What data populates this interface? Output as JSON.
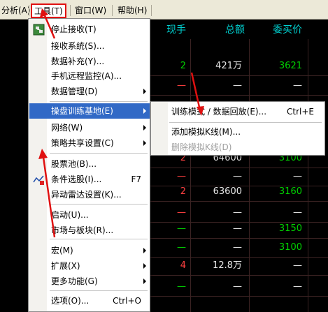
{
  "menubar": {
    "items": [
      {
        "label": "分析(A)",
        "active": false
      },
      {
        "label": "工具(T)",
        "active": true
      },
      {
        "label": "窗口(W)",
        "active": false
      },
      {
        "label": "帮助(H)",
        "active": false
      }
    ]
  },
  "table": {
    "headers": [
      "现手",
      "总额",
      "委买价"
    ],
    "rows": [
      {
        "shou": "2",
        "zong": "421万",
        "wei": "3621",
        "shou_color": "green",
        "wei_color": "green"
      },
      {
        "shou": "—",
        "zong": "—",
        "wei": "—",
        "shou_color": "red",
        "wei_color": "white"
      },
      {
        "shou": "2",
        "zong": "64600",
        "wei": "3100",
        "shou_color": "red",
        "wei_color": "green"
      },
      {
        "shou": "—",
        "zong": "—",
        "wei": "—",
        "shou_color": "red",
        "wei_color": "white"
      },
      {
        "shou": "2",
        "zong": "63600",
        "wei": "3160",
        "shou_color": "red",
        "wei_color": "green"
      },
      {
        "shou": "—",
        "zong": "—",
        "wei": "—",
        "shou_color": "red",
        "wei_color": "white"
      },
      {
        "shou": "—",
        "zong": "—",
        "wei": "3150",
        "shou_color": "green",
        "wei_color": "green"
      },
      {
        "shou": "—",
        "zong": "—",
        "wei": "3100",
        "shou_color": "green",
        "wei_color": "green"
      },
      {
        "shou": "4",
        "zong": "12.8万",
        "wei": "—",
        "shou_color": "red",
        "wei_color": "white"
      },
      {
        "shou": "—",
        "zong": "—",
        "wei": "—",
        "shou_color": "green",
        "wei_color": "white"
      }
    ]
  },
  "tools_menu": {
    "items": [
      {
        "label": "停止接收(T)",
        "shortcut": "",
        "submenu": false,
        "icon": "network-icon"
      },
      {
        "label": "接收系统(S)...",
        "shortcut": "",
        "submenu": false
      },
      {
        "label": "数据补充(Y)...",
        "shortcut": "",
        "submenu": false
      },
      {
        "label": "手机远程监控(A)...",
        "shortcut": "",
        "submenu": false
      },
      {
        "label": "数据管理(D)",
        "shortcut": "",
        "submenu": true
      },
      {
        "label": "操盘训练基地(E)",
        "shortcut": "",
        "submenu": true,
        "highlighted": true
      },
      {
        "label": "网络(W)",
        "shortcut": "",
        "submenu": true
      },
      {
        "label": "策略共享设置(C)",
        "shortcut": "",
        "submenu": true
      },
      {
        "label": "股票池(B)...",
        "shortcut": "",
        "submenu": false
      },
      {
        "label": "条件选股(I)...",
        "shortcut": "F7",
        "submenu": false,
        "icon": "chart-icon"
      },
      {
        "label": "异动雷达设置(K)...",
        "shortcut": "",
        "submenu": false
      },
      {
        "label": "启动(U)...",
        "shortcut": "",
        "submenu": false
      },
      {
        "label": "市场与板块(R)...",
        "shortcut": "",
        "submenu": false
      },
      {
        "label": "宏(M)",
        "shortcut": "",
        "submenu": true
      },
      {
        "label": "扩展(X)",
        "shortcut": "",
        "submenu": true
      },
      {
        "label": "更多功能(G)",
        "shortcut": "",
        "submenu": true
      },
      {
        "label": "选项(O)...",
        "shortcut": "Ctrl+O",
        "submenu": false
      }
    ]
  },
  "training_submenu": {
    "items": [
      {
        "label": "训练模式 / 数据回放(E)...",
        "shortcut": "Ctrl+E",
        "enabled": true
      },
      {
        "label": "添加模拟K线(M)...",
        "shortcut": "",
        "enabled": true
      },
      {
        "label": "删除模拟K线(D)",
        "shortcut": "",
        "enabled": false
      }
    ]
  },
  "colors": {
    "menu_highlight": "#3169c6",
    "annotation_red": "#e01010",
    "header_cyan": "#00d0d0",
    "price_green": "#00d000",
    "price_red": "#ff4040"
  }
}
